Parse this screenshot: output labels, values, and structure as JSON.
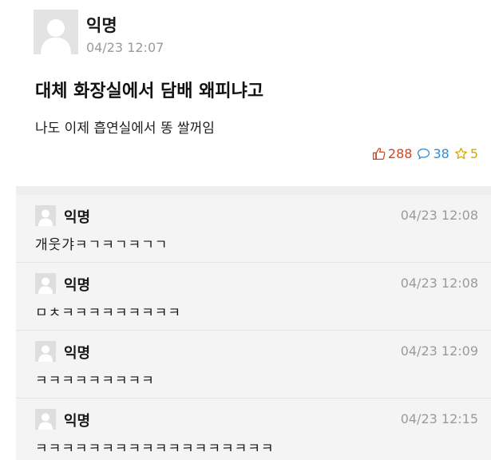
{
  "post": {
    "author": "익명",
    "time": "04/23 12:07",
    "title": "대체 화장실에서 담배 왜피냐고",
    "body": "나도 이제 흡연실에서 똥 쌀꺼임",
    "likes": "288",
    "comments": "38",
    "scraps": "5",
    "icons": {
      "like": "thumbs-up-icon",
      "comment": "speech-bubble-icon",
      "scrap": "star-icon"
    },
    "colors": {
      "like": "#d0461f",
      "comment": "#2e8bd8",
      "scrap": "#d8a400"
    }
  },
  "comments": [
    {
      "author": "익명",
      "time": "04/23 12:08",
      "text": "개웃갸ㅋㄱㅋㄱㅋㄱㄱ"
    },
    {
      "author": "익명",
      "time": "04/23 12:08",
      "text": "ㅁㅊㅋㅋㅋㅋㅋㅋㅋㅋㅋ"
    },
    {
      "author": "익명",
      "time": "04/23 12:09",
      "text": "ㅋㅋㅋㅋㅋㅋㅋㅋㅋ"
    },
    {
      "author": "익명",
      "time": "04/23 12:15",
      "text": "ㅋㅋㅋㅋㅋㅋㅋㅋㅋㅋㅋㅋㅋㅋㅋㅋㅋㅋ"
    }
  ]
}
